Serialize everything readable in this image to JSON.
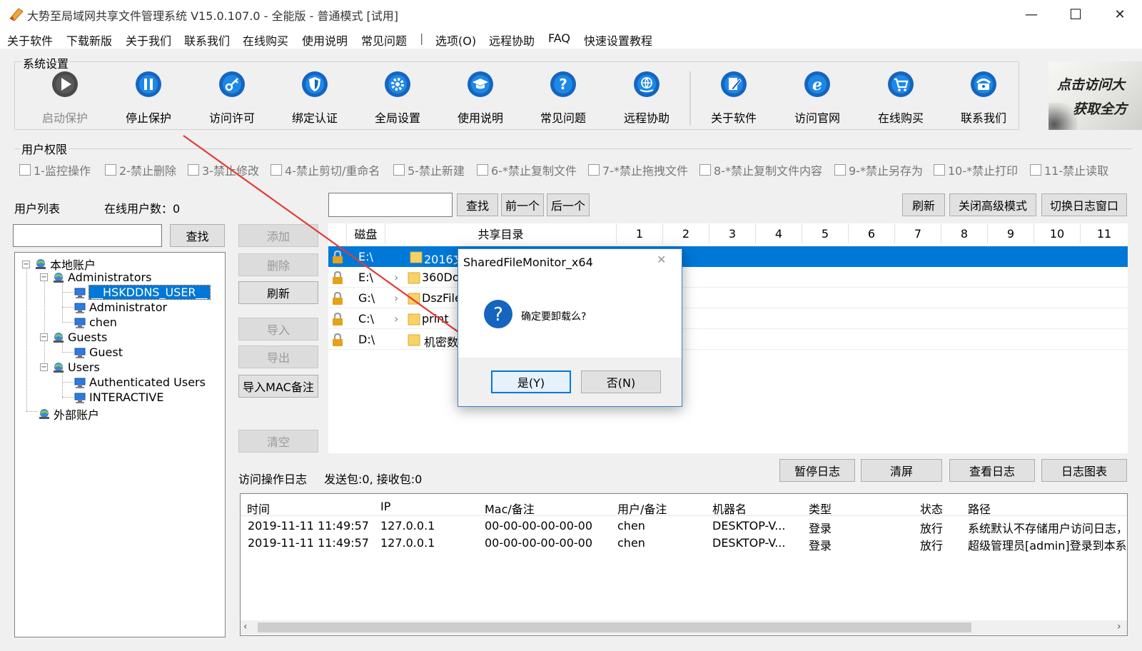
{
  "window": {
    "title": "大势至局域网共享文件管理系统 V15.0.107.0 - 全能版 - 普通模式 [试用]",
    "minimize": "—",
    "maximize": "☐",
    "close": "✕"
  },
  "menu": [
    "关于软件",
    "下载新版",
    "关于我们",
    "联系我们",
    "在线购买",
    "使用说明",
    "常见问题",
    "|",
    "选项(O)",
    "远程协助",
    "FAQ",
    "快速设置教程"
  ],
  "system_settings": {
    "title": "系统设置",
    "tools": [
      {
        "label": "启动保护",
        "icon": "play-icon",
        "enabled": false
      },
      {
        "label": "停止保护",
        "icon": "pause-icon",
        "enabled": true
      },
      {
        "label": "访问许可",
        "icon": "key-icon",
        "enabled": true
      },
      {
        "label": "绑定认证",
        "icon": "shield-icon",
        "enabled": true
      },
      {
        "label": "全局设置",
        "icon": "gear-icon",
        "enabled": true
      },
      {
        "label": "使用说明",
        "icon": "graduation-cap-icon",
        "enabled": true
      },
      {
        "label": "常见问题",
        "icon": "question-icon",
        "enabled": true
      },
      {
        "label": "远程协助",
        "icon": "globe-hand-icon",
        "enabled": true
      },
      {
        "label": "关于软件",
        "icon": "notebook-pen-icon",
        "enabled": true
      },
      {
        "label": "访问官网",
        "icon": "browser-e-icon",
        "enabled": true
      },
      {
        "label": "在线购买",
        "icon": "cart-icon",
        "enabled": true
      },
      {
        "label": "联系我们",
        "icon": "phone-icon",
        "enabled": true
      }
    ],
    "banner_line1": "点击访问大",
    "banner_line2": "获取全方"
  },
  "permissions": {
    "title": "用户权限",
    "items": [
      "1-监控操作",
      "2-禁止删除",
      "3-禁止修改",
      "4-禁止剪切/重命名",
      "5-禁止新建",
      "6-*禁止复制文件",
      "7-*禁止拖拽文件",
      "8-*禁止复制文件内容",
      "9-*禁止另存为",
      "10-*禁止打印",
      "11-禁止读取"
    ]
  },
  "user_list": {
    "label": "用户列表",
    "online_count": "在线用户数：0",
    "search_button": "查找",
    "tree": {
      "local": "本地账户",
      "administrators": "Administrators",
      "hsk_user": "__HSKDDNS_USER__",
      "administrator": "Administrator",
      "chen": "chen",
      "guests": "Guests",
      "guest": "Guest",
      "users": "Users",
      "auth_users": "Authenticated Users",
      "interactive": "INTERACTIVE",
      "external": "外部账户"
    }
  },
  "side_buttons": {
    "add": "添加",
    "delete": "删除",
    "refresh": "刷新",
    "import": "导入",
    "export": "导出",
    "import_mac": "导入MAC备注",
    "clear": "清空"
  },
  "share_toolbar": {
    "find": "查找",
    "prev": "前一个",
    "next": "后一个",
    "refresh": "刷新",
    "close_advanced": "关闭高级模式",
    "switch_log": "切换日志窗口"
  },
  "share_table": {
    "headers": [
      "磁盘",
      "共享目录",
      "1",
      "2",
      "3",
      "4",
      "5",
      "6",
      "7",
      "8",
      "9",
      "10",
      "11"
    ],
    "rows": [
      {
        "disk": "E:\\",
        "dir": "2016文",
        "selected": true,
        "arrow": false
      },
      {
        "disk": "E:\\",
        "dir": "360Do",
        "selected": false,
        "arrow": true
      },
      {
        "disk": "G:\\",
        "dir": "DszFile",
        "selected": false,
        "arrow": true
      },
      {
        "disk": "C:\\",
        "dir": "print",
        "selected": false,
        "arrow": true
      },
      {
        "disk": "D:\\",
        "dir": "机密数",
        "selected": false,
        "arrow": false
      }
    ]
  },
  "log": {
    "label": "访问操作日志",
    "packets": "发送包:0, 接收包:0",
    "buttons": {
      "pause": "暂停日志",
      "clear": "清屏",
      "view": "查看日志",
      "chart": "日志图表"
    },
    "headers": [
      "时间",
      "IP",
      "Mac/备注",
      "用户/备注",
      "机器名",
      "类型",
      "状态",
      "路径"
    ],
    "rows": [
      [
        "2019-11-11 11:49:57",
        "127.0.0.1",
        "00-00-00-00-00-00",
        "chen",
        "DESKTOP-V...",
        "登录",
        "放行",
        "系统默认不存储用户访问日志，"
      ],
      [
        "2019-11-11 11:49:57",
        "127.0.0.1",
        "00-00-00-00-00-00",
        "chen",
        "DESKTOP-V...",
        "登录",
        "放行",
        "超级管理员[admin]登录到本系"
      ]
    ]
  },
  "dialog": {
    "title": "SharedFileMonitor_x64",
    "message": "确定要卸载么?",
    "yes": "是(Y)",
    "no": "否(N)",
    "close": "✕"
  },
  "colors": {
    "accent_blue": "#0078d7",
    "selection": "#0078d7",
    "icon_blue": "#1565c0",
    "arrow_red": "#e53935",
    "lock_gold": "#e3a21a",
    "folder_yellow": "#f6d365"
  }
}
